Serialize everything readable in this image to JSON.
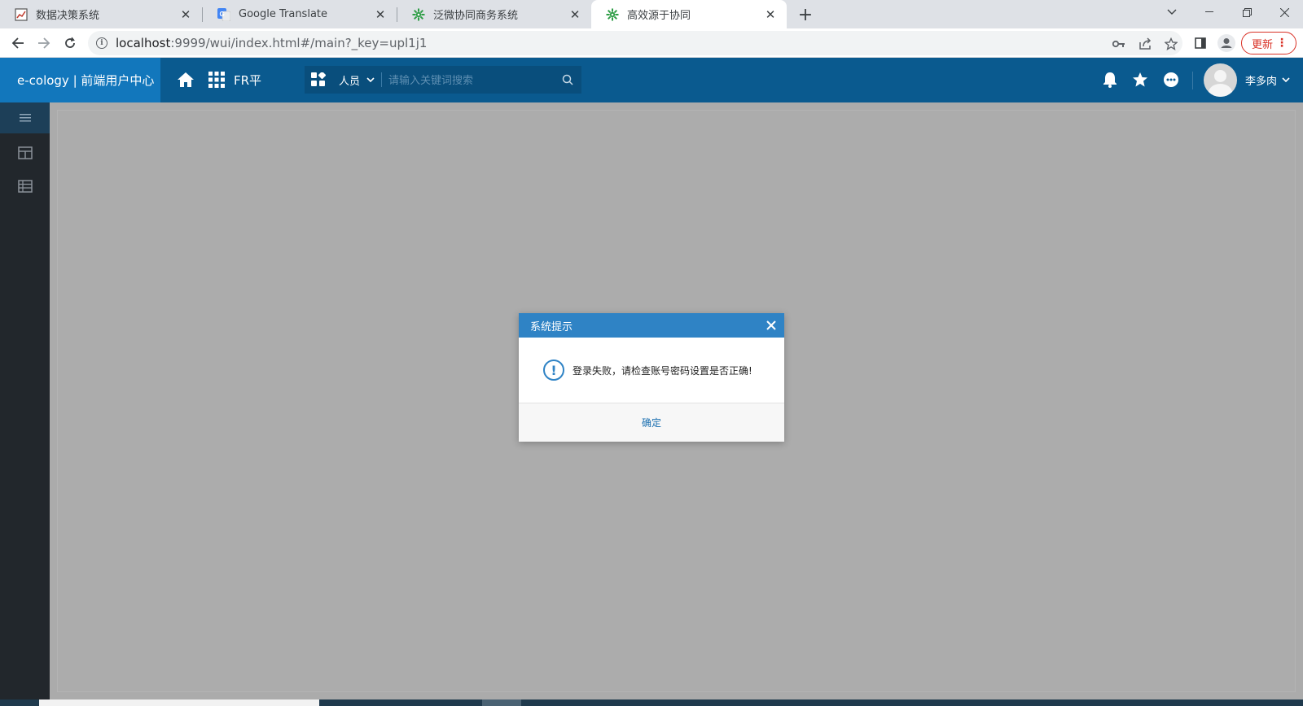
{
  "browser": {
    "tabs": [
      {
        "title": "数据决策系统",
        "icon": "chart-report-icon",
        "active": false
      },
      {
        "title": "Google Translate",
        "icon": "google-translate-icon",
        "active": false
      },
      {
        "title": "泛微协同商务系统",
        "icon": "weaver-gear-icon",
        "active": false
      },
      {
        "title": "高效源于协同",
        "icon": "weaver-gear-icon",
        "active": true
      }
    ],
    "url_host": "localhost",
    "url_rest": ":9999/wui/index.html#/main?_key=upl1j1",
    "update_label": "更新"
  },
  "app": {
    "brand": "e-cology | 前端用户中心",
    "module_label": "FR平",
    "search": {
      "type_label": "人员",
      "placeholder": "请输入关键词搜索"
    },
    "user_name": "李多肉",
    "header_color": "#0a5a8f",
    "brand_color": "#1277bc"
  },
  "dialog": {
    "title": "系统提示",
    "message": "登录失败，请检查账号密码设置是否正确!",
    "ok_label": "确定",
    "accent": "#2f83c5"
  }
}
